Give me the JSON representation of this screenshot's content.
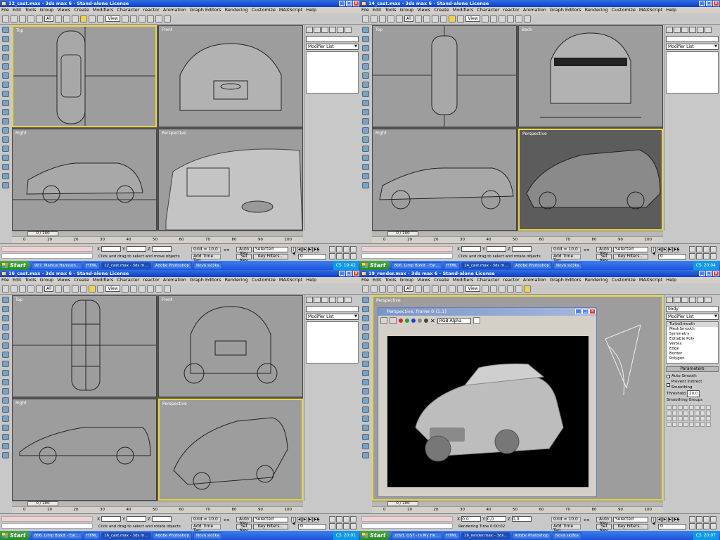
{
  "windows": [
    {
      "title": "12_cast.max - 3ds max 6 - Stand-alone License",
      "menu": [
        "File",
        "Edit",
        "Tools",
        "Group",
        "Views",
        "Create",
        "Modifiers",
        "Character",
        "reactor",
        "Animation",
        "Graph Editors",
        "Rendering",
        "Customize",
        "MAXScript",
        "Help"
      ],
      "toolbar": {
        "filter": "All",
        "view": "View"
      },
      "viewports": [
        "Top",
        "Front",
        "Right",
        "Perspective"
      ],
      "panel": {
        "modifier_list": "Modifier List"
      },
      "time_slider": "0 / 100",
      "ruler": [
        "0",
        "10",
        "20",
        "30",
        "40",
        "50",
        "60",
        "70",
        "80",
        "90",
        "100"
      ],
      "status": {
        "x": "X",
        "y": "Y",
        "z": "Z",
        "grid": "Grid = 10,0",
        "add_time_tag": "Add Time Tag",
        "auto_key": "Auto Key",
        "set_key": "Set Key",
        "selected": "Selected",
        "key_filters": "Key Filters...",
        "frame": "0",
        "prompt": "Click and drag to select and move objects"
      },
      "taskbar": {
        "start": "Start",
        "items": [
          "907. Markus Hansson…",
          "HTML",
          "12_cast.max - 3ds m…",
          "Adobe Photoshop",
          "Nová složka"
        ],
        "tray": "CS",
        "clock": "19:42"
      }
    },
    {
      "title": "14_cast.max - 3ds max 6 - Stand-alone License",
      "menu": [
        "File",
        "Edit",
        "Tools",
        "Group",
        "Views",
        "Create",
        "Modifiers",
        "Character",
        "reactor",
        "Animation",
        "Graph Editors",
        "Rendering",
        "Customize",
        "MAXScript",
        "Help"
      ],
      "toolbar": {
        "filter": "All",
        "view": "View"
      },
      "viewports": [
        "Top",
        "Back",
        "Right",
        "Perspective"
      ],
      "panel": {
        "modifier_list": "Modifier List"
      },
      "time_slider": "0 / 100",
      "ruler": [
        "0",
        "10",
        "20",
        "30",
        "40",
        "50",
        "60",
        "70",
        "80",
        "90",
        "100"
      ],
      "status": {
        "x": "X",
        "y": "Y",
        "z": "Z",
        "grid": "Grid = 10,0",
        "add_time_tag": "Add Time Tag",
        "auto_key": "Auto Key",
        "set_key": "Set Key",
        "selected": "Selected",
        "key_filters": "Key Filters...",
        "frame": "0",
        "prompt": "Click and drag to select and rotate objects"
      },
      "taskbar": {
        "start": "Start",
        "items": [
          "806. Limp Bizkit - Eat…",
          "HTML",
          "14_cast.max - 3ds m…",
          "Adobe Photoshop",
          "Nová složka"
        ],
        "tray": "CS",
        "clock": "20:04"
      }
    },
    {
      "title": "16_cast.max - 3ds max 6 - Stand-alone License",
      "menu": [
        "File",
        "Edit",
        "Tools",
        "Group",
        "Views",
        "Create",
        "Modifiers",
        "Character",
        "reactor",
        "Animation",
        "Graph Editors",
        "Rendering",
        "Customize",
        "MAXScript",
        "Help"
      ],
      "toolbar": {
        "filter": "All",
        "view": "View"
      },
      "viewports": [
        "Top",
        "Front",
        "Right",
        "Perspective"
      ],
      "panel": {
        "modifier_list": "Modifier List"
      },
      "time_slider": "0 / 100",
      "ruler": [
        "0",
        "10",
        "20",
        "30",
        "40",
        "50",
        "60",
        "70",
        "80",
        "90",
        "100"
      ],
      "status": {
        "x": "X",
        "y": "Y",
        "z": "Z",
        "grid": "Grid = 10,0",
        "add_time_tag": "Add Time Tag",
        "auto_key": "Auto Key",
        "set_key": "Set Key",
        "selected": "Selected",
        "key_filters": "Key Filters...",
        "frame": "0",
        "prompt": "Click and drag to select and rotate objects"
      },
      "taskbar": {
        "start": "Start",
        "items": [
          "806. Limp Bizkit - Eat…",
          "HTML",
          "16_cast.max - 3ds m…",
          "Adobe Photoshop",
          "Nová složka"
        ],
        "tray": "CS",
        "clock": "20:01"
      }
    },
    {
      "title": "19_render.max - 3ds max 6 - Stand-alone License",
      "menu": [
        "File",
        "Edit",
        "Tools",
        "Group",
        "Views",
        "Create",
        "Modifiers",
        "Character",
        "reactor",
        "Animation",
        "Graph Editors",
        "Rendering",
        "Customize",
        "MAXScript",
        "Help"
      ],
      "toolbar": {
        "filter": "All",
        "view": "View"
      },
      "viewports": [
        "Perspective"
      ],
      "panel": {
        "modifier_list": "Modifier List",
        "name": "body",
        "stack": [
          "TurboSmooth",
          "MeshSmooth",
          "Symmetry",
          "Editable Poly",
          "Vertex",
          "Edge",
          "Border",
          "Polygon"
        ],
        "rollout": "Parameters",
        "auto_smooth": "Auto Smooth",
        "prevent_indirect": "Prevent Indirect Smoothing",
        "threshold_label": "Threshold",
        "threshold": "20,0",
        "smoothing_groups": "Smoothing Groups"
      },
      "render_window": {
        "title": "Perspective, frame 0 (1:1)",
        "channel": "RGB Alpha"
      },
      "time_slider": "0 / 100",
      "ruler": [
        "0",
        "10",
        "20",
        "30",
        "40",
        "50",
        "60",
        "70",
        "80",
        "90",
        "100"
      ],
      "status": {
        "x": "X",
        "y": "Y",
        "z": "Z",
        "x_val": "0,0",
        "y_val": "0,0",
        "z_val": "0,0",
        "grid": "Grid = 10,0",
        "add_time_tag": "Add Time Tag",
        "auto_key": "Auto Key",
        "set_key": "Set Key",
        "selected": "Selected",
        "key_filters": "Key Filters...",
        "frame": "0",
        "prompt": "Rendering Time 0:00:02"
      },
      "taskbar": {
        "start": "Start",
        "items": [
          "2093. OST - In My He…",
          "HTML",
          "19_render.max - 3ds…",
          "Adobe Photoshop",
          "Nová složka"
        ],
        "tray": "CS",
        "clock": "20:07"
      }
    }
  ],
  "colors": {
    "titlebar": "#0a3fc4",
    "active_viewport": "#e8d640",
    "taskbar": "#1d52d8",
    "start": "#2a8a2a"
  }
}
